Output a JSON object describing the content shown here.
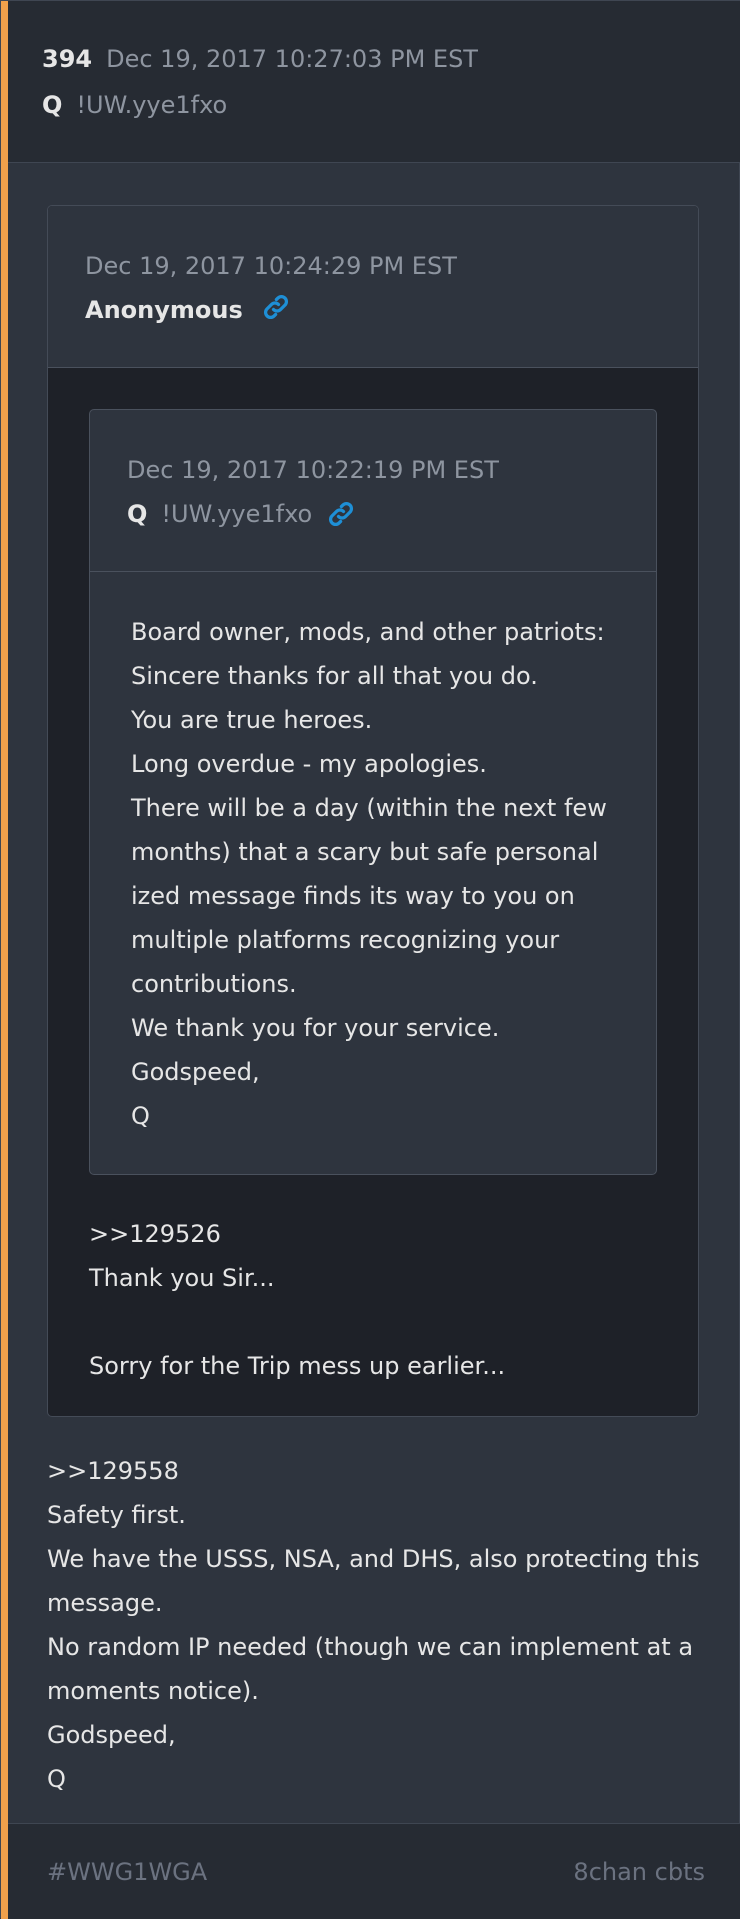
{
  "post": {
    "number": "394",
    "date": "Dec 19, 2017 10:27:03 PM EST",
    "author": "Q",
    "tripcode": "!UW.yye1fxo",
    "accent_color": "#f0a04b"
  },
  "outer_quote": {
    "date": "Dec 19, 2017 10:24:29 PM EST",
    "author": "Anonymous",
    "link_icon": "link-icon",
    "body_lines": [
      ">>129526",
      "Thank you Sir...",
      "",
      "Sorry for the Trip mess up earlier..."
    ]
  },
  "inner_quote": {
    "date": "Dec 19, 2017 10:22:19 PM EST",
    "author": "Q",
    "tripcode": "!UW.yye1fxo",
    "link_icon": "link-icon",
    "body_lines": [
      "Board owner, mods, and other patriots:",
      "Sincere thanks for all that you do.",
      "You are true heroes.",
      "Long overdue - my apologies.",
      "There will be a day (within the next few",
      "months) that a scary but safe personal",
      "ized message finds its way to you on",
      "multiple platforms recognizing your",
      "contributions.",
      "We thank you for your service.",
      "Godspeed,",
      "Q"
    ]
  },
  "body_lines": [
    ">>129558",
    "Safety first.",
    "We have the USSS, NSA, and DHS, also protecting this",
    "message.",
    "No random IP needed (though we can implement at a",
    "moments notice).",
    "Godspeed,",
    "Q"
  ],
  "footer": {
    "tag": "#WWG1WGA",
    "source": "8chan cbts"
  },
  "colors": {
    "link": "#1e8fd6",
    "background": "#2e343e",
    "quote_background": "#1e2128"
  }
}
